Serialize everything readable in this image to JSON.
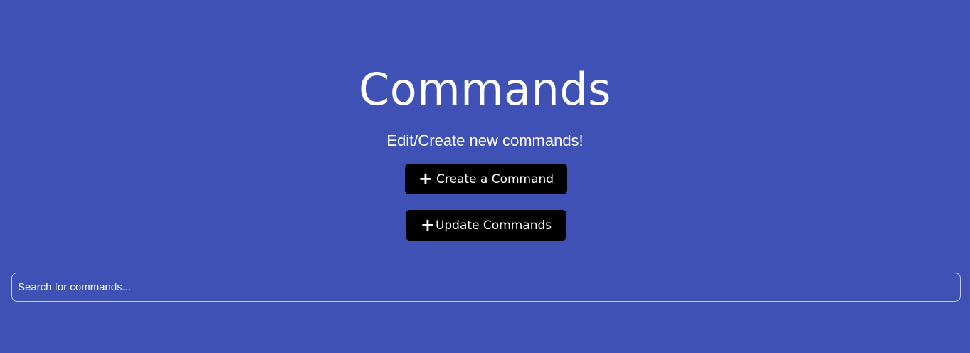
{
  "header": {
    "title": "Commands",
    "subtitle": "Edit/Create new commands!"
  },
  "actions": {
    "create_label": "Create a Command",
    "update_label": "Update Commands",
    "icon": "plus-icon"
  },
  "search": {
    "placeholder": "Search for commands...",
    "value": ""
  },
  "colors": {
    "background": "#3f51b5",
    "button_bg": "#000000",
    "text": "#ffffff"
  }
}
